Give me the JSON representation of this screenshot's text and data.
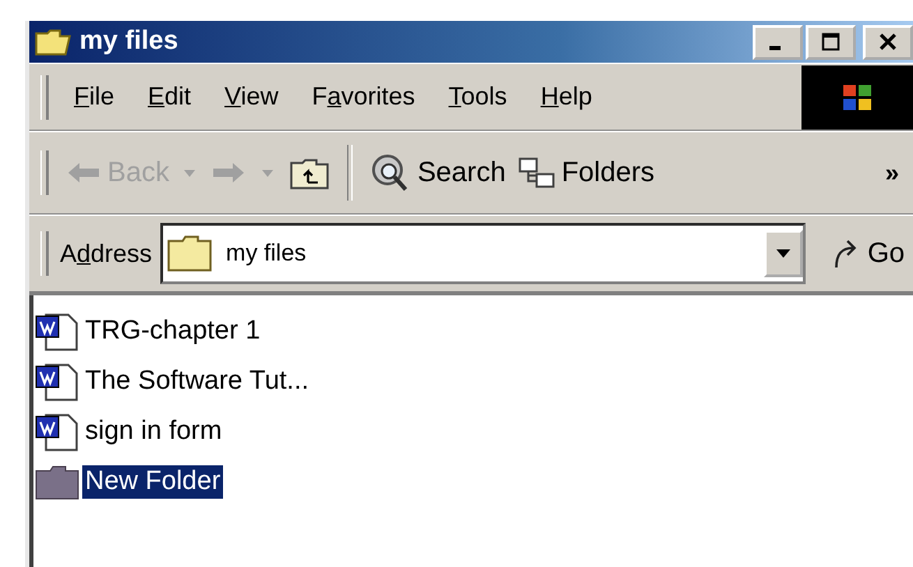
{
  "window": {
    "title": "my files"
  },
  "menu": [
    {
      "key": "F",
      "post": "ile"
    },
    {
      "key": "E",
      "post": "dit"
    },
    {
      "key": "V",
      "post": "iew"
    },
    {
      "pre": "F",
      "key": "a",
      "post": "vorites"
    },
    {
      "key": "T",
      "post": "ools"
    },
    {
      "key": "H",
      "post": "elp"
    }
  ],
  "toolbar": {
    "back": {
      "label": "Back",
      "disabled": true
    },
    "forward": {
      "disabled": true
    },
    "search": {
      "label": "Search"
    },
    "folders": {
      "label": "Folders"
    },
    "more": "»"
  },
  "address": {
    "label": {
      "pre": "A",
      "key": "d",
      "post": "dress"
    },
    "value": "my files",
    "go": "Go"
  },
  "files": [
    {
      "name": "TRG-chapter 1",
      "kind": "document",
      "selected": false
    },
    {
      "name": "The Software Tut...",
      "kind": "document",
      "selected": false
    },
    {
      "name": "sign in form",
      "kind": "document",
      "selected": false
    },
    {
      "name": "New Folder",
      "kind": "folder",
      "selected": true
    }
  ]
}
